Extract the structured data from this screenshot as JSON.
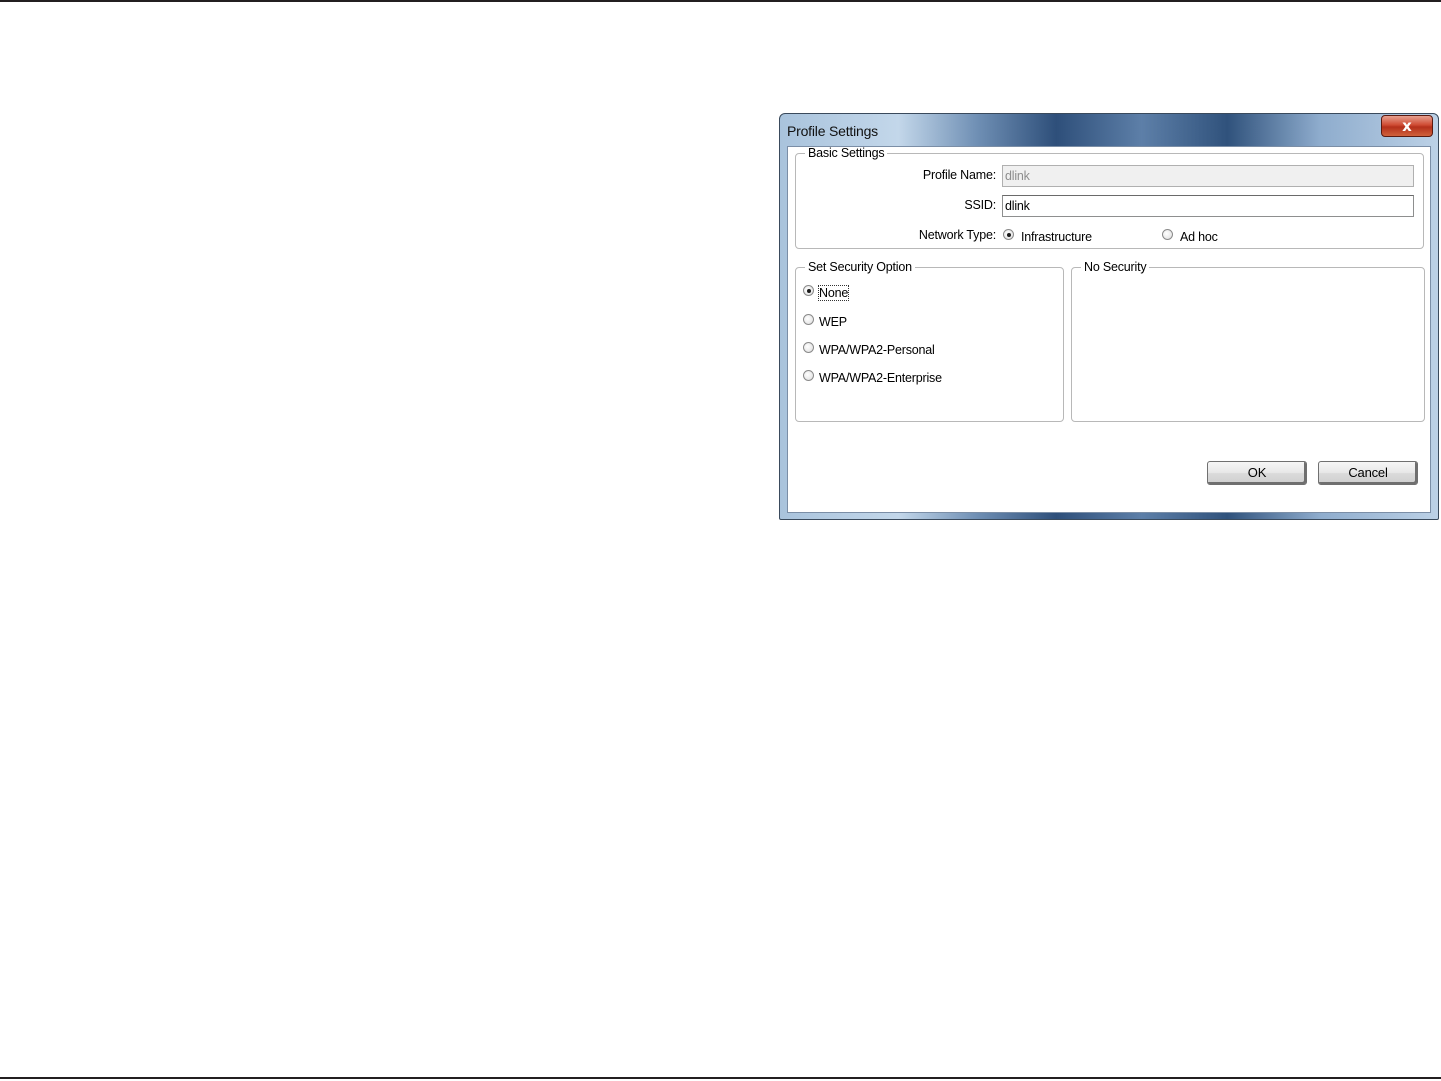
{
  "window": {
    "title": "Profile Settings",
    "close_glyph": "x"
  },
  "basic_settings": {
    "legend": "Basic Settings",
    "profile_name_label": "Profile Name:",
    "profile_name_value": "dlink",
    "ssid_label": "SSID:",
    "ssid_value": "dlink",
    "network_type_label": "Network Type:",
    "network_type_options": [
      {
        "label": "Infrastructure",
        "selected": true
      },
      {
        "label": "Ad hoc",
        "selected": false
      }
    ]
  },
  "security_option": {
    "legend": "Set Security Option",
    "options": [
      {
        "label": "None",
        "selected": true
      },
      {
        "label": "WEP",
        "selected": false
      },
      {
        "label": "WPA/WPA2-Personal",
        "selected": false
      },
      {
        "label": "WPA/WPA2-Enterprise",
        "selected": false
      }
    ]
  },
  "security_detail": {
    "legend": "No Security"
  },
  "buttons": {
    "ok": "OK",
    "cancel": "Cancel"
  },
  "icons": {
    "close": "close-icon",
    "radio": "radio-button"
  },
  "colors": {
    "close_button": "#cf4b33",
    "title_bar_dark": "#2e4f7a",
    "title_bar_light": "#c3d7ea"
  }
}
